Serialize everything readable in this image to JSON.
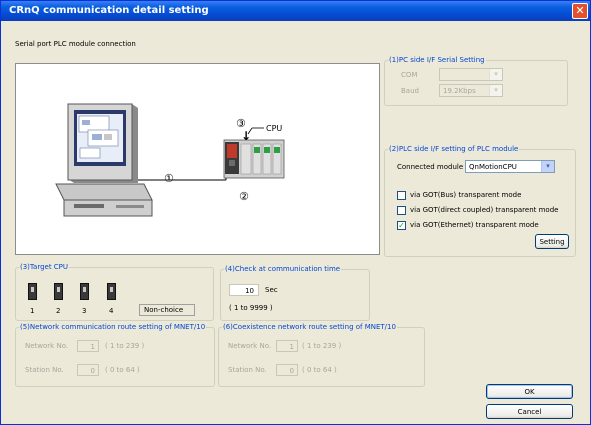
{
  "window": {
    "title": "CRnQ communication detail setting",
    "close_glyph": "✕"
  },
  "connection": {
    "label": "Serial port PLC module connection"
  },
  "diagram": {
    "marker1": "①",
    "marker2": "②",
    "marker3": "③",
    "cpu_label": "CPU",
    "arrow_glyph": "↓"
  },
  "pc_side": {
    "legend": "(1)PC side I/F Serial Setting",
    "com_label": "COM",
    "com_value": "",
    "baud_label": "Baud",
    "baud_value": "19.2Kbps",
    "arrow_glyph": "▾"
  },
  "plc_side": {
    "legend": "(2)PLC side I/F setting of PLC module",
    "connected_module_label": "Connected module",
    "connected_module_value": "QnMotionCPU",
    "arrow_glyph": "▾",
    "options": [
      {
        "label": "via GOT(Bus) transparent mode",
        "checked": false
      },
      {
        "label": "via GOT(direct coupled) transparent mode",
        "checked": false
      },
      {
        "label": "via GOT(Ethernet) transparent mode",
        "checked": true
      }
    ],
    "check_glyph": "✓",
    "setting_button": "Setting"
  },
  "target_cpu": {
    "legend": "(3)Target CPU",
    "cpus": [
      "1",
      "2",
      "3",
      "4"
    ],
    "non_choice": "Non-choice"
  },
  "check_time": {
    "legend": "(4)Check at communication time",
    "value": "10",
    "unit": "Sec",
    "range": "( 1 to 9999 )"
  },
  "network_route": {
    "legend": "(5)Network communication route setting of MNET/10",
    "network_label": "Network No.",
    "network_value": "1",
    "network_range": "( 1 to 239 )",
    "station_label": "Station No.",
    "station_value": "0",
    "station_range": "( 0 to 64 )"
  },
  "coexistence_route": {
    "legend": "(6)Coexistence network route setting of MNET/10",
    "network_label": "Network No.",
    "network_value": "1",
    "network_range": "( 1 to 239 )",
    "station_label": "Station No.",
    "station_value": "0",
    "station_range": "( 0 to 64 )"
  },
  "buttons": {
    "ok": "OK",
    "cancel": "Cancel"
  }
}
